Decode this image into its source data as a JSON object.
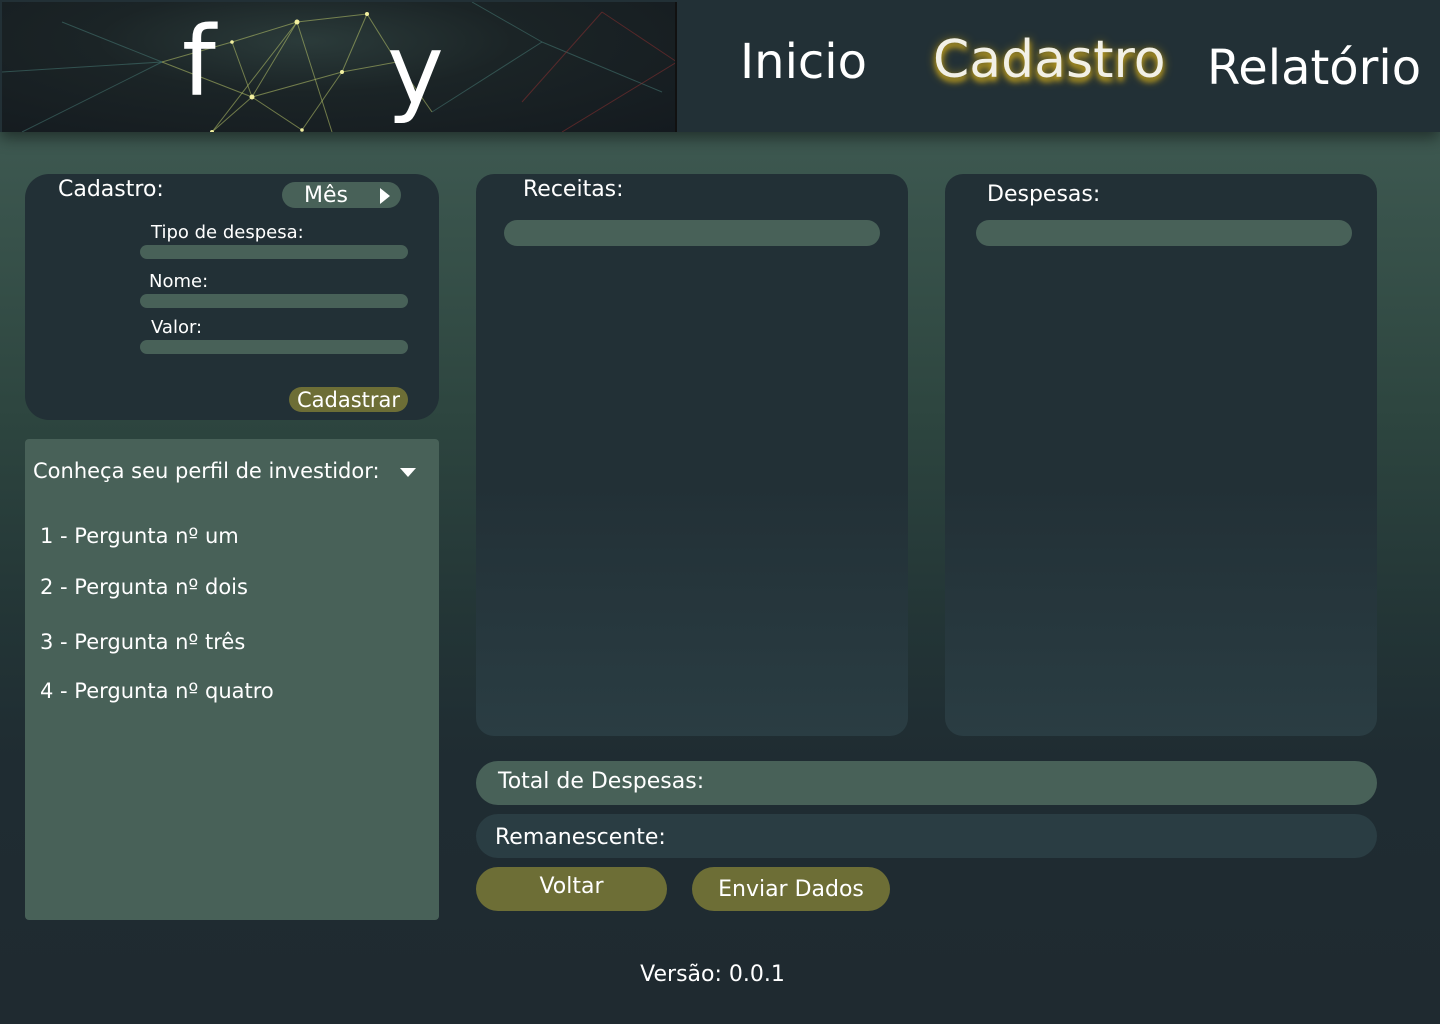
{
  "logo": {
    "letter_left": "f",
    "letter_right": "y"
  },
  "nav": {
    "items": [
      {
        "label": "Inicio",
        "active": false
      },
      {
        "label": "Cadastro",
        "active": true
      },
      {
        "label": "Relatório",
        "active": false
      }
    ],
    "active_glow_color": "#c0a020"
  },
  "cadastro": {
    "title": "Cadastro:",
    "month_button": "Mês",
    "fields": [
      {
        "label": "Tipo de despesa:",
        "value": ""
      },
      {
        "label": "Nome:",
        "value": ""
      },
      {
        "label": "Valor:",
        "value": ""
      }
    ],
    "submit_label": "Cadastrar"
  },
  "investor": {
    "title": "Conheça seu perfil de investidor:",
    "questions": [
      "1 - Pergunta nº um",
      "2 - Pergunta nº dois",
      "3 - Pergunta nº três",
      "4 - Pergunta nº quatro"
    ]
  },
  "receitas": {
    "title": "Receitas:",
    "value": ""
  },
  "despesas": {
    "title": "Despesas:",
    "value": ""
  },
  "totals": {
    "total_label": "Total de Despesas:",
    "remaining_label": "Remanescente:"
  },
  "actions": {
    "back_label": "Voltar",
    "send_label": "Enviar Dados"
  },
  "footer": {
    "version": "Versão: 0.0.1"
  },
  "colors": {
    "panel_dark": "#223036",
    "panel_light": "#486158",
    "button_olive": "#6d6e36",
    "background_top": "#45635a",
    "background_bottom": "#1f2a30"
  },
  "icons": {
    "month_arrow": "caret-right-icon",
    "dropdown": "caret-down-icon"
  }
}
